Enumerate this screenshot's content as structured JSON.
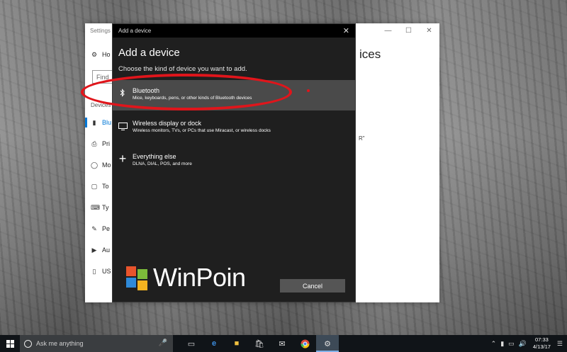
{
  "settings": {
    "title": "Settings",
    "heading_fragment": "ices",
    "snippet_fragment": "R\"",
    "find_placeholder": "Find",
    "section_fragment": "Devices",
    "nav_items": [
      {
        "icon": "home-icon",
        "label": "Ho"
      },
      {
        "icon": "bluetooth-icon",
        "label": "Blu"
      },
      {
        "icon": "printer-icon",
        "label": "Pri"
      },
      {
        "icon": "mouse-icon",
        "label": "Mo"
      },
      {
        "icon": "touchpad-icon",
        "label": "To"
      },
      {
        "icon": "keyboard-icon",
        "label": "Ty"
      },
      {
        "icon": "pen-icon",
        "label": "Pe"
      },
      {
        "icon": "autoplay-icon",
        "label": "Au"
      },
      {
        "icon": "usb-icon",
        "label": "US"
      }
    ]
  },
  "dialog": {
    "title": "Add a device",
    "heading": "Add a device",
    "subtitle": "Choose the kind of device you want to add.",
    "options": [
      {
        "icon": "bluetooth-icon",
        "title": "Bluetooth",
        "description": "Mice, keyboards, pens, or other kinds of Bluetooth devices",
        "selected": true
      },
      {
        "icon": "monitor-icon",
        "title": "Wireless display or dock",
        "description": "Wireless monitors, TVs, or PCs that use Miracast, or wireless docks",
        "selected": false
      },
      {
        "icon": "plus-icon",
        "title": "Everything else",
        "description": "DLNA, DIAL, POS, and more",
        "selected": false
      }
    ],
    "cancel_label": "Cancel"
  },
  "watermark": {
    "text": "WinPoin",
    "colors": [
      "#e8542c",
      "#7cbb3a",
      "#2f8ad8",
      "#f3b320"
    ]
  },
  "taskbar": {
    "search_placeholder": "Ask me anything",
    "apps": [
      "task-view-icon",
      "edge-icon",
      "file-explorer-icon",
      "store-icon",
      "mail-icon",
      "chrome-icon",
      "settings-gear-icon"
    ],
    "active_app": "settings-gear-icon",
    "time": "07:33",
    "date": "4/13/17"
  },
  "colors": {
    "accent": "#0078d7",
    "highlight": "#e0151b",
    "dialog_bg": "#1f1f1f",
    "selected_row": "#4a4a4a"
  }
}
